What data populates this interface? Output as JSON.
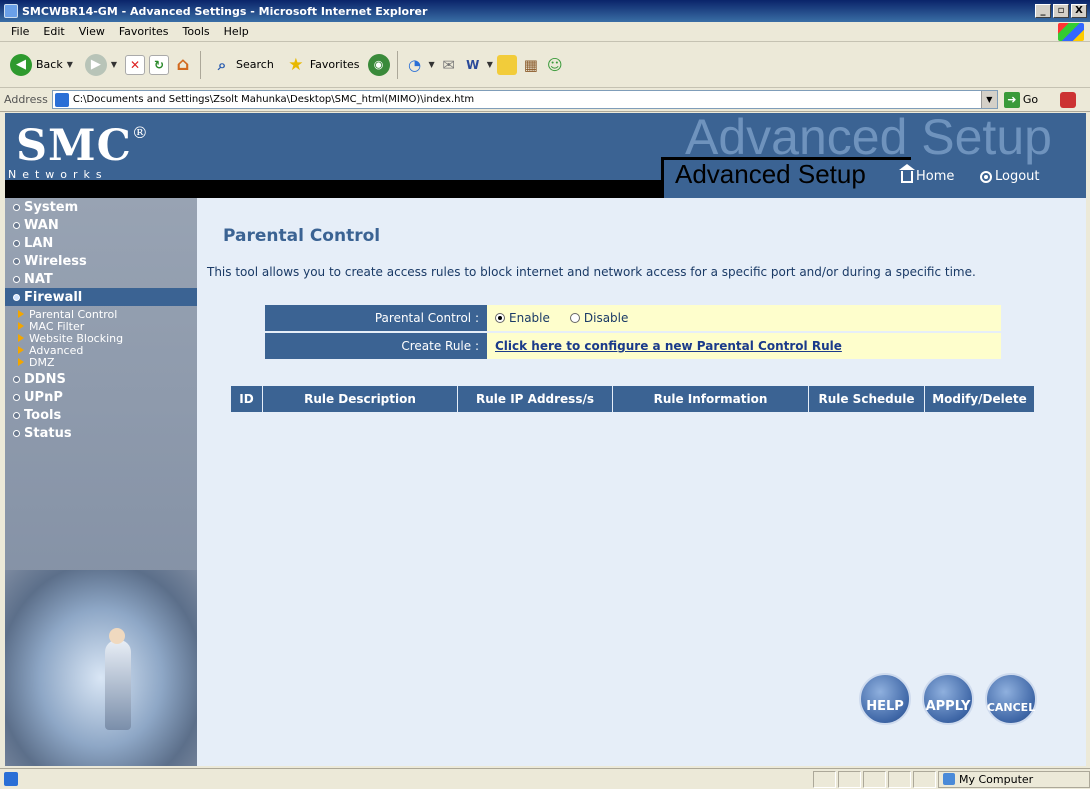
{
  "window": {
    "title": "SMCWBR14-GM - Advanced Settings - Microsoft Internet Explorer",
    "buttons": [
      "_",
      "▫",
      "X"
    ]
  },
  "menu": [
    "File",
    "Edit",
    "View",
    "Favorites",
    "Tools",
    "Help"
  ],
  "toolbar": {
    "back": "Back",
    "search": "Search",
    "favorites": "Favorites"
  },
  "address": {
    "label": "Address",
    "value": "C:\\Documents and Settings\\Zsolt Mahunka\\Desktop\\SMC_html(MIMO)\\index.htm",
    "go": "Go"
  },
  "banner": {
    "logo": "SMC",
    "registered": "®",
    "networks": "Networks",
    "ghost_title": "Advanced Setup",
    "title": "Advanced Setup",
    "home": "Home",
    "logout": "Logout"
  },
  "sidebar": {
    "items": [
      {
        "label": "System"
      },
      {
        "label": "WAN"
      },
      {
        "label": "LAN"
      },
      {
        "label": "Wireless"
      },
      {
        "label": "NAT"
      },
      {
        "label": "Firewall"
      },
      {
        "label": "DDNS"
      },
      {
        "label": "UPnP"
      },
      {
        "label": "Tools"
      },
      {
        "label": "Status"
      }
    ],
    "firewall_sub": [
      {
        "label": "Parental Control"
      },
      {
        "label": "MAC Filter"
      },
      {
        "label": "Website Blocking"
      },
      {
        "label": "Advanced"
      },
      {
        "label": "DMZ"
      }
    ]
  },
  "main": {
    "title": "Parental Control",
    "description": "This tool allows you to create access rules to block internet and network access for a specific port and/or during a specific time.",
    "parental_label": "Parental Control :",
    "enable": "Enable",
    "disable": "Disable",
    "create_label": "Create Rule :",
    "create_link": "Click here to configure a new Parental Control Rule",
    "columns": [
      "ID",
      "Rule Description",
      "Rule IP Address/s",
      "Rule Information",
      "Rule Schedule",
      "Modify/Delete"
    ],
    "help": "HELP",
    "apply": "APPLY",
    "cancel": "CANCEL"
  },
  "status": {
    "zone": "My Computer"
  }
}
